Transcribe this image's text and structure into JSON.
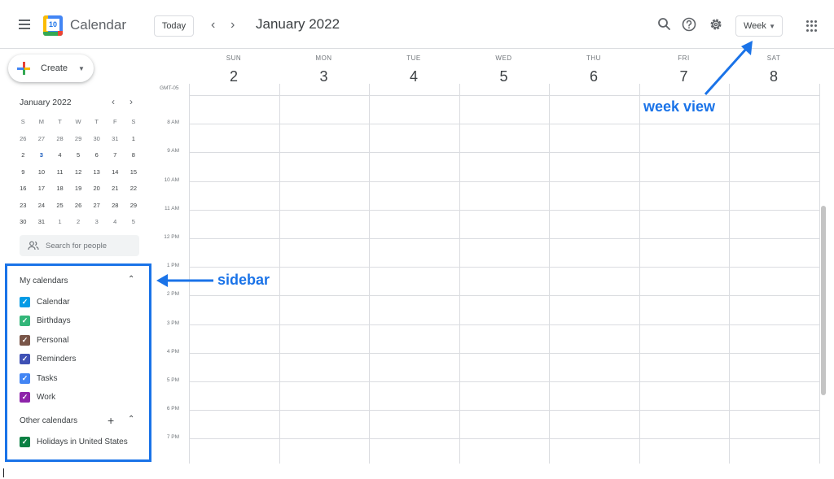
{
  "header": {
    "app_title": "Calendar",
    "logo_day": "10",
    "today_label": "Today",
    "prev_icon": "chevron-left-icon",
    "next_icon": "chevron-right-icon",
    "month_title": "January 2022",
    "search_icon": "search-icon",
    "help_icon": "help-icon",
    "settings_icon": "gear-icon",
    "view_label": "Week",
    "apps_icon": "apps-grid-icon",
    "menu_icon": "hamburger-menu-icon"
  },
  "sidebar": {
    "create_label": "Create",
    "mini_calendar": {
      "title": "January 2022",
      "weekday_initials": [
        "S",
        "M",
        "T",
        "W",
        "T",
        "F",
        "S"
      ],
      "weeks": [
        [
          "26",
          "27",
          "28",
          "29",
          "30",
          "31",
          "1"
        ],
        [
          "2",
          "3",
          "4",
          "5",
          "6",
          "7",
          "8"
        ],
        [
          "9",
          "10",
          "11",
          "12",
          "13",
          "14",
          "15"
        ],
        [
          "16",
          "17",
          "18",
          "19",
          "20",
          "21",
          "22"
        ],
        [
          "23",
          "24",
          "25",
          "26",
          "27",
          "28",
          "29"
        ],
        [
          "30",
          "31",
          "1",
          "2",
          "3",
          "4",
          "5"
        ]
      ],
      "selected_day": "3"
    },
    "people_search_placeholder": "Search for people",
    "my_calendars": {
      "title": "My calendars",
      "items": [
        {
          "label": "Calendar",
          "color": "#039be5"
        },
        {
          "label": "Birthdays",
          "color": "#33b679"
        },
        {
          "label": "Personal",
          "color": "#795548"
        },
        {
          "label": "Reminders",
          "color": "#3f51b5"
        },
        {
          "label": "Tasks",
          "color": "#4285f4"
        },
        {
          "label": "Work",
          "color": "#8e24aa"
        }
      ]
    },
    "other_calendars": {
      "title": "Other calendars",
      "items": [
        {
          "label": "Holidays in United States",
          "color": "#0b8043"
        }
      ]
    }
  },
  "week": {
    "timezone": "GMT-05",
    "days": [
      {
        "dow": "SUN",
        "num": "2"
      },
      {
        "dow": "MON",
        "num": "3"
      },
      {
        "dow": "TUE",
        "num": "4"
      },
      {
        "dow": "WED",
        "num": "5"
      },
      {
        "dow": "THU",
        "num": "6"
      },
      {
        "dow": "FRI",
        "num": "7"
      },
      {
        "dow": "SAT",
        "num": "8"
      }
    ],
    "times": [
      "8 AM",
      "9 AM",
      "10 AM",
      "11 AM",
      "12 PM",
      "1 PM",
      "2 PM",
      "3 PM",
      "4 PM",
      "5 PM",
      "6 PM",
      "7 PM"
    ]
  },
  "annotations": {
    "week_view": "week view",
    "sidebar": "sidebar",
    "color": "#1a73e8"
  }
}
